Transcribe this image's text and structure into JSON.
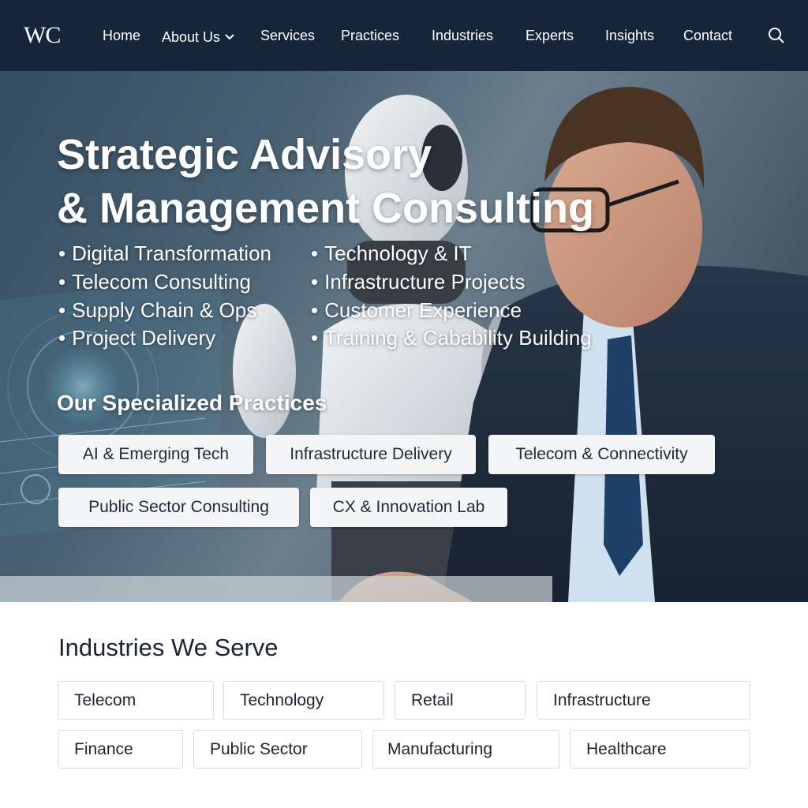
{
  "brand": {
    "logo": "WC"
  },
  "nav": {
    "items": [
      "Home",
      "About Us",
      "Services",
      "Practices",
      "Industries",
      "Experts",
      "Insights",
      "Contact"
    ]
  },
  "hero": {
    "title_line1": "Strategic Advisory",
    "title_line2": "& Management Consulting",
    "services_left": [
      "Digital Transformation",
      "Telecom Consulting",
      "Supply Chain & Ops",
      "Project Delivery"
    ],
    "services_right": [
      "Technology & IT",
      "Infrastructure Projects",
      "Customer Experience",
      "Training & Cabability Building"
    ],
    "practices_title": "Our Specialized Practices",
    "practices": [
      "AI & Emerging Tech",
      "Infrastructure Delivery",
      "Telecom & Connectivity",
      "Public Sector Consulting",
      "CX & Innovation Lab"
    ]
  },
  "industries": {
    "title": "Industries We Serve",
    "items": [
      "Telecom",
      "Technology",
      "Retail",
      "Infrastructure",
      "Finance",
      "Public Sector",
      "Manufacturing",
      "Healthcare"
    ]
  },
  "colors": {
    "nav_bg": "#16253a",
    "chip_bg": "#f3f5f7",
    "text_dark": "#1b2433"
  },
  "icons": {
    "search": "search-icon",
    "dropdown": "chevron-down-icon"
  }
}
